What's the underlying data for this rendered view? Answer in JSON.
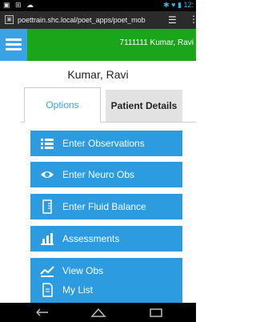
{
  "status_bar": {
    "left_icons": "▣ ⊞ ☁",
    "right_text": "✱ ♥ ▮ 12:"
  },
  "browser": {
    "url": "poettrain.shc.local/poet_apps/poet_mob",
    "menu_icon": "menu-icon",
    "more_icon": "more-icon"
  },
  "header": {
    "id_name": "7111111  Kumar, Ravi",
    "accent": "#1aa51a"
  },
  "patient": {
    "name": "Kumar, Ravi"
  },
  "tabs": [
    {
      "label": "Options"
    },
    {
      "label": "Patient Details"
    }
  ],
  "menu": [
    {
      "label": "Enter Observations",
      "icon": "list-icon"
    },
    {
      "label": "Enter Neuro Obs",
      "icon": "eye-icon"
    },
    {
      "label": "Enter Fluid Balance",
      "icon": "fluid-icon"
    },
    {
      "label": "Assessments",
      "icon": "chart-icon"
    },
    {
      "label": "View Obs",
      "icon": "trend-icon"
    },
    {
      "label": "My List",
      "icon": "doc-icon"
    }
  ],
  "colors": {
    "button": "#2c9be0",
    "hamburger": "#3aa3e6"
  }
}
